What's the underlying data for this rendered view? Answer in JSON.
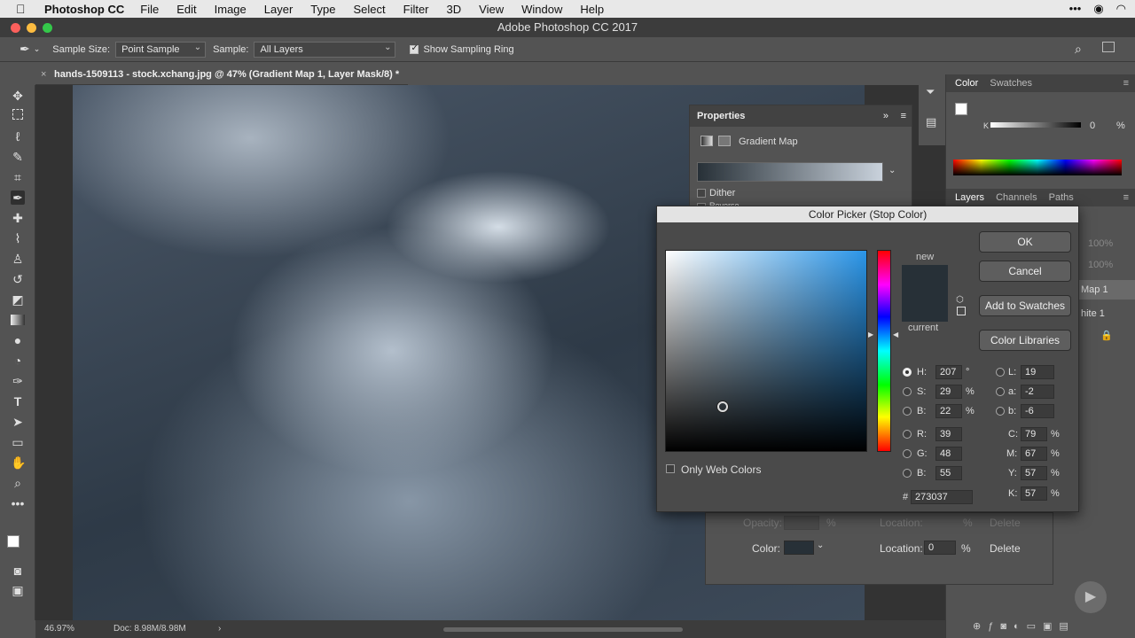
{
  "menubar": {
    "app_name": "Photoshop CC",
    "items": [
      "File",
      "Edit",
      "Image",
      "Layer",
      "Type",
      "Select",
      "Filter",
      "3D",
      "View",
      "Window",
      "Help"
    ]
  },
  "window": {
    "title": "Adobe Photoshop CC 2017"
  },
  "options_bar": {
    "sample_size_label": "Sample Size:",
    "sample_size_value": "Point Sample",
    "sample_label": "Sample:",
    "sample_value": "All Layers",
    "show_ring_label": "Show Sampling Ring",
    "show_ring_checked": true
  },
  "document": {
    "tab_title": "hands-1509113 - stock.xchang.jpg @ 47% (Gradient Map 1, Layer Mask/8) *"
  },
  "statusbar": {
    "zoom": "46.97%",
    "doc_size": "Doc: 8.98M/8.98M"
  },
  "properties": {
    "title": "Properties",
    "type_label": "Gradient Map",
    "dither_label": "Dither",
    "reverse_label": "Reverse"
  },
  "color_panel": {
    "tabs": [
      "Color",
      "Swatches"
    ],
    "k_label": "K",
    "k_value": "0",
    "k_unit": "%"
  },
  "layers_panel": {
    "tabs": [
      "Layers",
      "Channels",
      "Paths"
    ],
    "opacity_partial": "100%",
    "fill_partial": "100%",
    "layer1_partial": "Map 1",
    "layer2_partial": "hite 1"
  },
  "gradient_editor": {
    "opacity_label": "Opacity:",
    "opacity_unit": "%",
    "location_label": "Location:",
    "location_unit": "%",
    "delete_label": "Delete",
    "color_label": "Color:",
    "location_value": "0",
    "location_unit2": "%",
    "delete_label2": "Delete"
  },
  "color_picker": {
    "title": "Color Picker (Stop Color)",
    "ok": "OK",
    "cancel": "Cancel",
    "add_swatches": "Add to Swatches",
    "color_libraries": "Color Libraries",
    "new_label": "new",
    "current_label": "current",
    "only_web_label": "Only Web Colors",
    "new_color": "#273037",
    "current_color": "#273037",
    "hsb": {
      "H": "207",
      "S": "29",
      "B": "22",
      "h_unit": "°",
      "s_unit": "%",
      "b_unit": "%"
    },
    "lab": {
      "L": "19",
      "a": "-2",
      "b": "-6"
    },
    "rgb": {
      "R": "39",
      "G": "48",
      "B": "55"
    },
    "cmyk": {
      "C": "79",
      "M": "67",
      "Y": "57",
      "K": "57",
      "unit": "%"
    },
    "hex_label": "#",
    "hex": "273037"
  }
}
